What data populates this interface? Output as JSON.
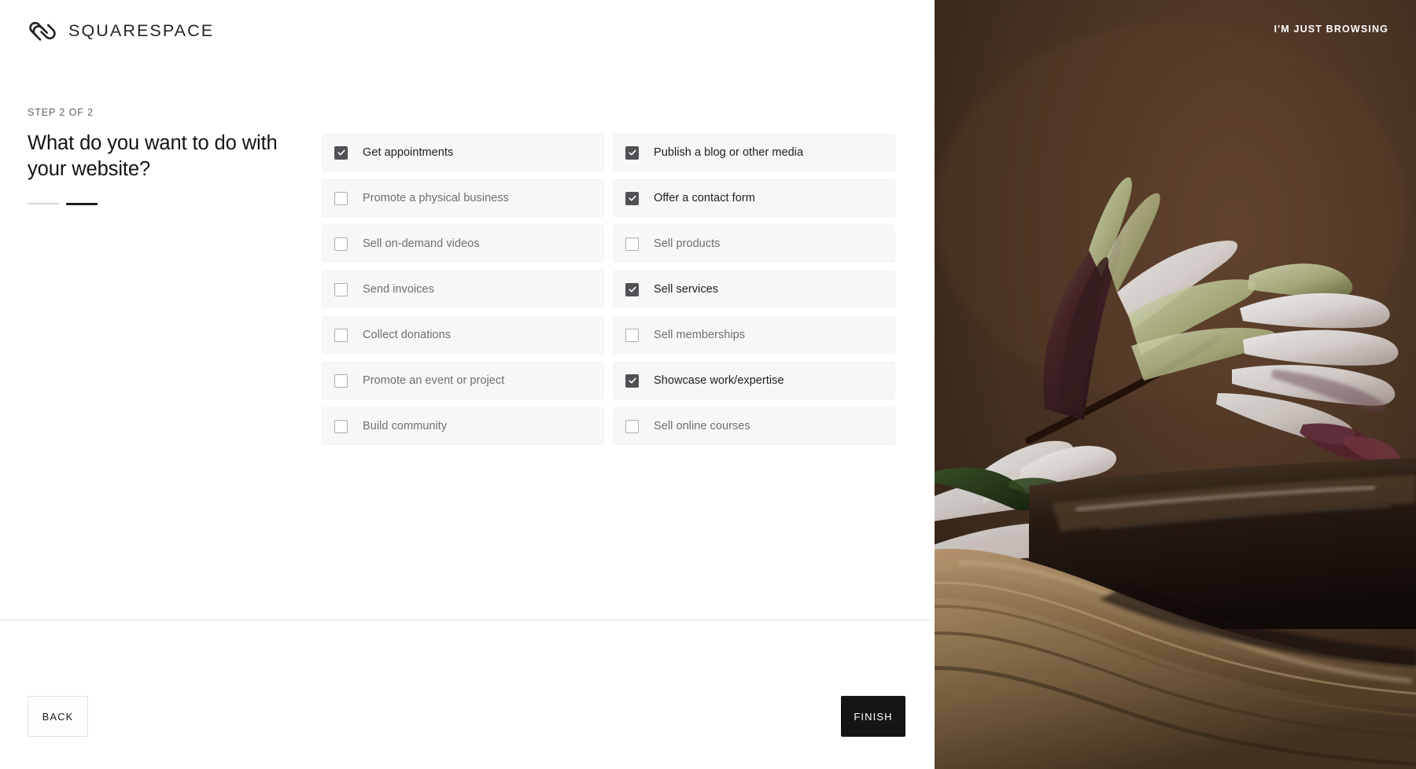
{
  "brand": {
    "name": "SQUARESPACE",
    "logo_icon": "squarespace-logo-icon",
    "logo_color": "#222326",
    "accent_color": "#151515"
  },
  "header": {
    "browsing_link": "I'M JUST BROWSING"
  },
  "wizard": {
    "step_label": "STEP 2 OF 2",
    "heading": "What do you want to do with your website?",
    "total_steps": 2,
    "current_step": 2
  },
  "options": {
    "left_column": [
      {
        "label": "Get appointments",
        "checked": true
      },
      {
        "label": "Promote a physical business",
        "checked": false
      },
      {
        "label": "Sell on-demand videos",
        "checked": false
      },
      {
        "label": "Send invoices",
        "checked": false
      },
      {
        "label": "Collect donations",
        "checked": false
      },
      {
        "label": "Promote an event or project",
        "checked": false
      },
      {
        "label": "Build community",
        "checked": false
      }
    ],
    "right_column": [
      {
        "label": "Publish a blog or other media",
        "checked": true
      },
      {
        "label": "Offer a contact form",
        "checked": true
      },
      {
        "label": "Sell products",
        "checked": false
      },
      {
        "label": "Sell services",
        "checked": true
      },
      {
        "label": "Sell memberships",
        "checked": false
      },
      {
        "label": "Showcase work/expertise",
        "checked": true
      },
      {
        "label": "Sell online courses",
        "checked": false
      }
    ]
  },
  "footer": {
    "back_label": "BACK",
    "finish_label": "FINISH"
  },
  "photo": {
    "description": "white lily flowers over a wooden bowl of dark water",
    "background_color": "#4a3225",
    "wood_color": "#a98b63"
  }
}
